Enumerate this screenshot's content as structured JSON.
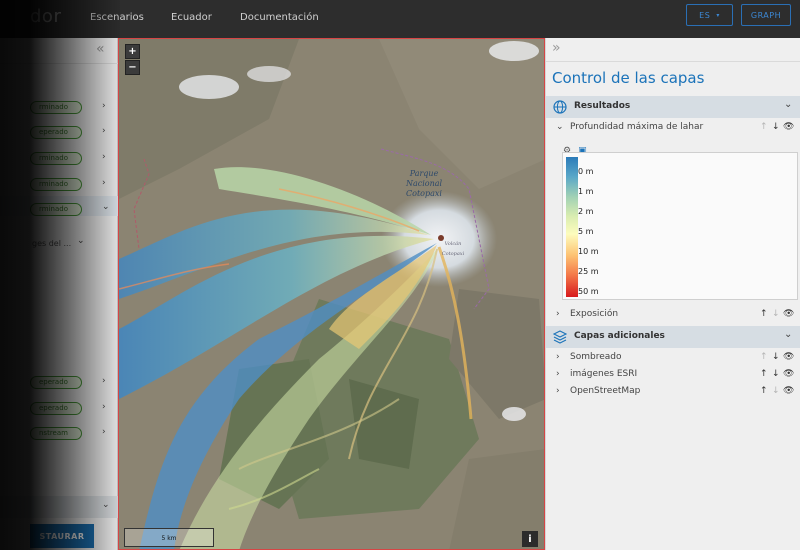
{
  "header": {
    "brand": "dor",
    "nav": [
      "Escenarios",
      "Ecuador",
      "Documentación"
    ],
    "language_label": "ES",
    "graph_label": "GRAPH"
  },
  "left_panel": {
    "statuses": [
      "rminado",
      "eperado",
      "rminado",
      "rminado",
      "rminado",
      "eperado",
      "eperado",
      "nstream"
    ],
    "truncated_label": "ges del ...",
    "restore_label": "STAURAR"
  },
  "map": {
    "zoom_in": "+",
    "zoom_out": "−",
    "scale_label": "5 km",
    "info_label": "i",
    "place_park": "Parque Nacional Cotopaxi",
    "place_volcano": "Volcán Cotopaxi"
  },
  "right_panel": {
    "title": "Control de las capas",
    "results_section": {
      "label": "Resultados",
      "layers": [
        {
          "name": "Profundidad máxima de lahar"
        },
        {
          "name": "Exposición"
        }
      ]
    },
    "legend": {
      "ticks": [
        "0 m",
        "1 m",
        "2 m",
        "5 m",
        "10 m",
        "25 m",
        "50 m"
      ],
      "ramp_colors": [
        "#2b7bb9",
        "#59a7c8",
        "#9fd0b5",
        "#d8ecb0",
        "#fdfcbd",
        "#fdc374",
        "#f47a4a",
        "#d7191c"
      ]
    },
    "additional_section": {
      "label": "Capas adicionales",
      "layers": [
        {
          "name": "Sombreado"
        },
        {
          "name": "imágenes ESRI"
        },
        {
          "name": "OpenStreetMap"
        }
      ]
    }
  },
  "colors": {
    "accent": "#1b73b9",
    "restore_button": "#1b6fb0",
    "status_green": "#4a9a3a"
  }
}
